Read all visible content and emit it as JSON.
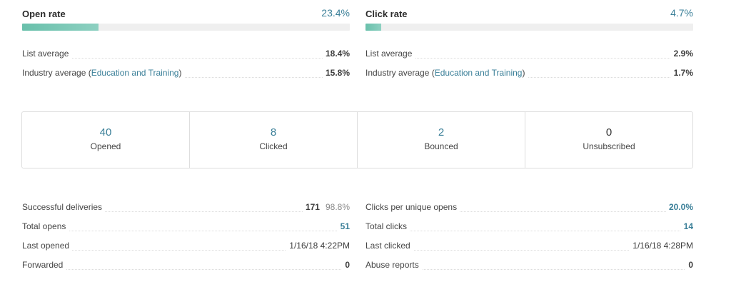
{
  "open_rate": {
    "title": "Open rate",
    "value": "23.4%",
    "fill_fraction": 0.234,
    "list_avg_label": "List average",
    "list_avg_value": "18.4%",
    "industry_prefix": "Industry average (",
    "industry_name": "Education and Training",
    "industry_suffix": ")",
    "industry_value": "15.8%"
  },
  "click_rate": {
    "title": "Click rate",
    "value": "4.7%",
    "fill_fraction": 0.047,
    "list_avg_label": "List average",
    "list_avg_value": "2.9%",
    "industry_prefix": "Industry average (",
    "industry_name": "Education and Training",
    "industry_suffix": ")",
    "industry_value": "1.7%"
  },
  "summary": [
    {
      "value": "40",
      "label": "Opened"
    },
    {
      "value": "8",
      "label": "Clicked"
    },
    {
      "value": "2",
      "label": "Bounced"
    },
    {
      "value": "0",
      "label": "Unsubscribed"
    }
  ],
  "details_left": {
    "deliveries_label": "Successful deliveries",
    "deliveries_count": "171",
    "deliveries_pct": "98.8%",
    "total_opens_label": "Total opens",
    "total_opens_value": "51",
    "last_opened_label": "Last opened",
    "last_opened_value": "1/16/18 4:22PM",
    "forwarded_label": "Forwarded",
    "forwarded_value": "0"
  },
  "details_right": {
    "cpuo_label": "Clicks per unique opens",
    "cpuo_value": "20.0%",
    "total_clicks_label": "Total clicks",
    "total_clicks_value": "14",
    "last_clicked_label": "Last clicked",
    "last_clicked_value": "1/16/18 4:28PM",
    "abuse_label": "Abuse reports",
    "abuse_value": "0"
  },
  "colors": {
    "accent": "#3a7f98",
    "bar_fill": "#69c0ab",
    "bar_track": "#efefef"
  }
}
